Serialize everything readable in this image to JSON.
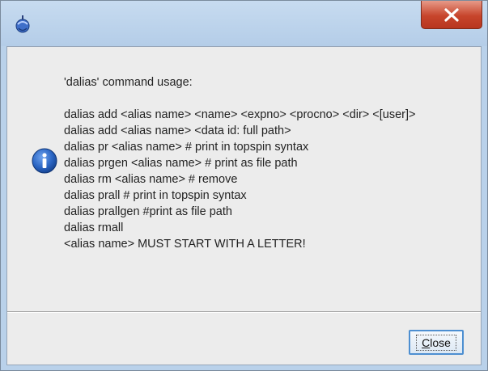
{
  "dialog": {
    "message_lines": [
      "'dalias' command usage:",
      "",
      "dalias add <alias name> <name> <expno> <procno> <dir> <[user]>",
      "dalias add <alias name> <data id: full path>",
      "dalias pr <alias name> # print in topspin syntax",
      "dalias prgen <alias name> # print as file path",
      "dalias rm <alias name> # remove",
      "dalias prall # print in topspin syntax",
      "dalias prallgen #print as file path",
      "dalias rmall",
      "<alias name> MUST START WITH A LETTER!"
    ],
    "close_button": {
      "mnemonic": "C",
      "rest": "lose"
    }
  },
  "icons": {
    "app": "topspin-app-icon",
    "titlebar_close": "close-icon",
    "message": "info-icon"
  },
  "colors": {
    "titlebar": "#b9d1ea",
    "close_red": "#c7452c",
    "dialog_bg": "#ececec",
    "info_blue": "#1f5fb8",
    "button_focus": "#4d8fd1"
  }
}
